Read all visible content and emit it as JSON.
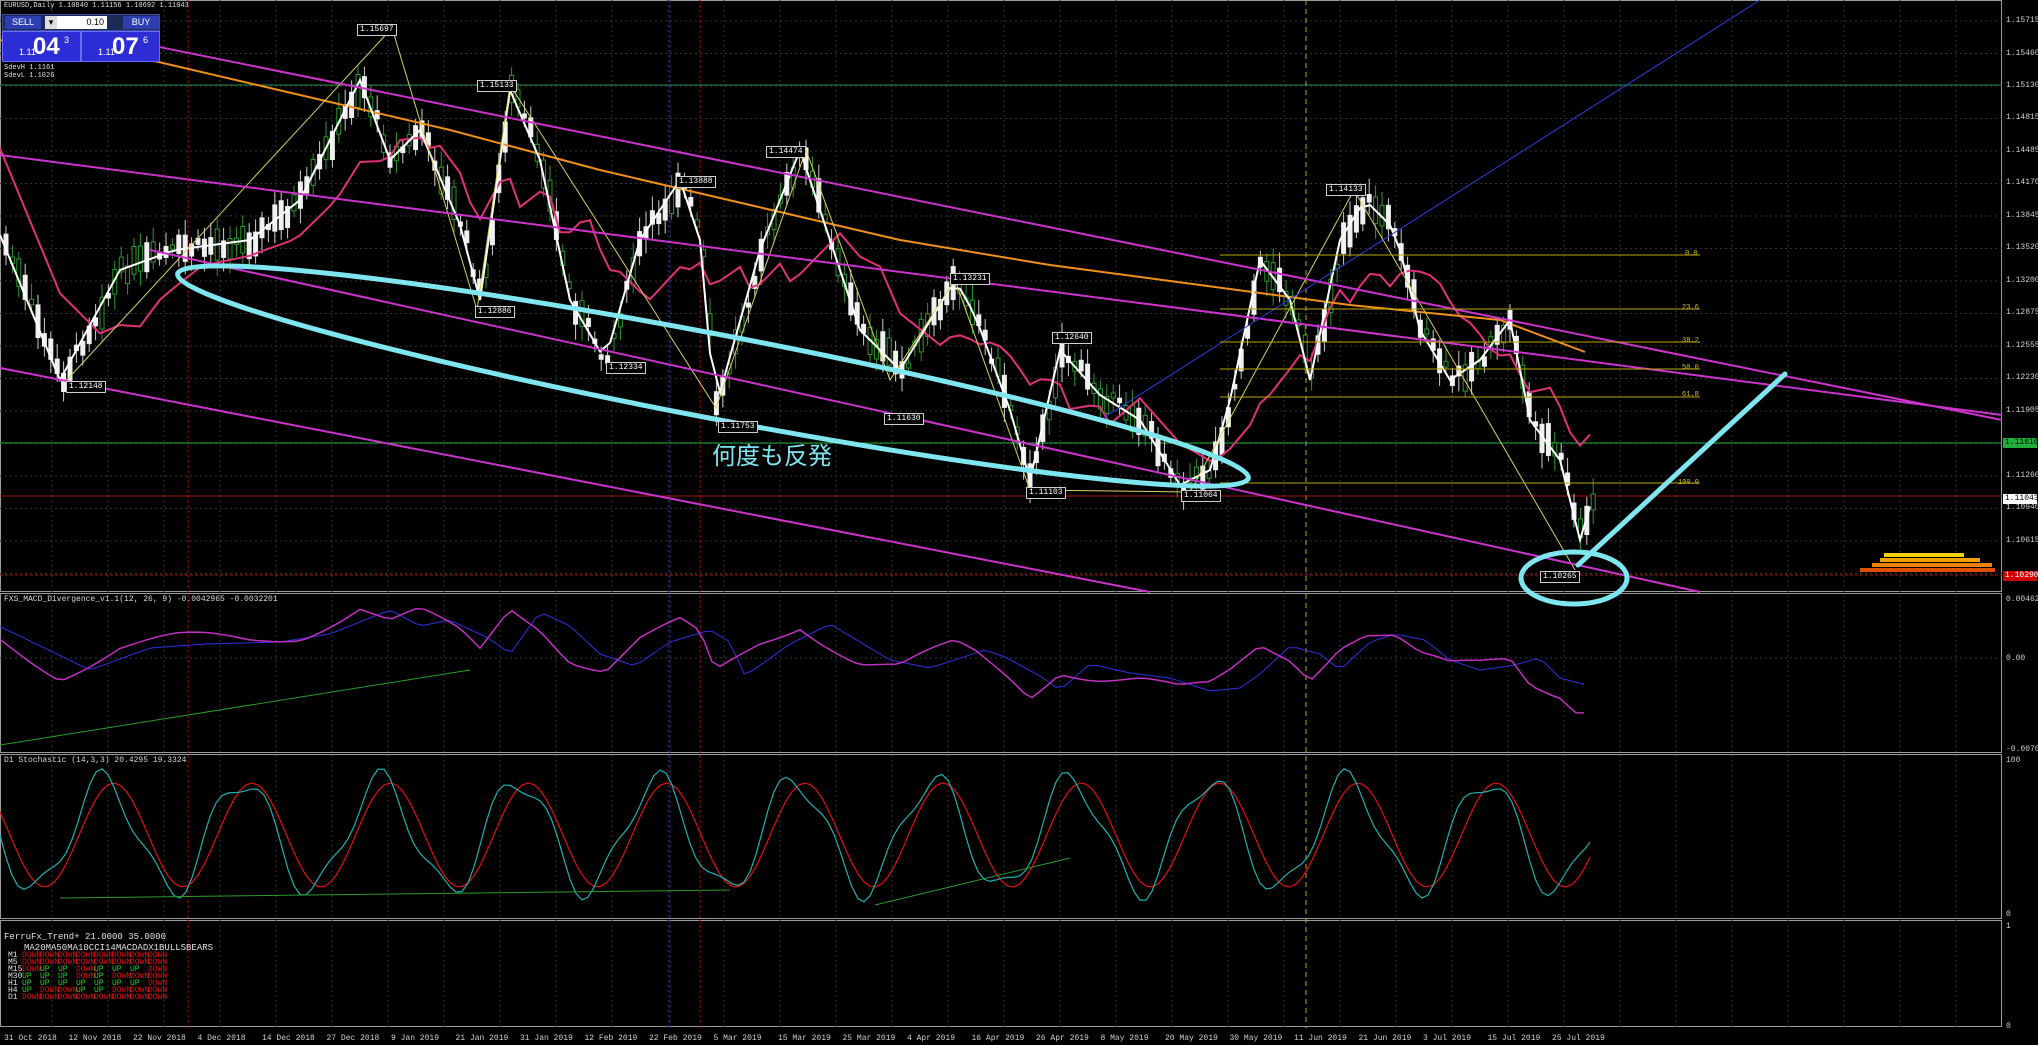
{
  "window": {
    "title": "EURUSD,Daily 1.10840 1.11156 1.10692 1.11043"
  },
  "trade_panel": {
    "sell_label": "SELL",
    "buy_label": "BUY",
    "lot": "0.10",
    "bid_prefix": "1.11",
    "bid_big": "04",
    "bid_sup": "3",
    "ask_prefix": "1.11",
    "ask_big": "07",
    "ask_sup": "6"
  },
  "info_lines": [
    "SdevH 1.1161",
    "SdevL 1.1026"
  ],
  "price_axis": [
    "1.15715",
    "1.15460",
    "1.15130",
    "1.14815",
    "1.14485",
    "1.14170",
    "1.13845",
    "1.13520",
    "1.13200",
    "1.12875",
    "1.12555",
    "1.12230",
    "1.11905",
    "1.11580",
    "1.11260",
    "1.10940",
    "1.10615",
    "1.10290"
  ],
  "price_tags": {
    "green": "1.11610",
    "current": "1.11043",
    "red": "1.10290"
  },
  "zigzag_labels": [
    "1.15697",
    "1.15133",
    "1.14474",
    "1.13888",
    "1.14133",
    "1.13231",
    "1.12640",
    "1.12886",
    "1.12334",
    "1.11753",
    "1.11630",
    "1.11103",
    "1.11064",
    "1.12148",
    "1.10265"
  ],
  "fib_levels": [
    "0.0",
    "23.6",
    "38.2",
    "50.0",
    "61.8",
    "100.0"
  ],
  "annotation": "何度も反発",
  "macd": {
    "label": "FXS_MACD_Divergence_v1.1(12, 26, 9) -0.0042965 -0.0032201",
    "axis": [
      "0.0046224",
      "0.00",
      "-0.007029"
    ]
  },
  "stoch": {
    "label": "D1 Stochastic (14,3,3) 20.4295 19.3324",
    "axis": [
      "100",
      "0"
    ]
  },
  "trend": {
    "label": "FerruFx_Trend+ 21.0000 35.0000",
    "columns": "MA20MA50MA10CCI14MACDADX1BULLSBEARS",
    "rows": [
      {
        "tf": "M1",
        "v": [
          "DOWN",
          "DOWN",
          "DOWN",
          "DOWN",
          "DOWN",
          "DOWN",
          "DOWN",
          "DOWN"
        ]
      },
      {
        "tf": "M5",
        "v": [
          "DOWN",
          "DOWN",
          "DOWN",
          "DOWN",
          "DOWN",
          "DOWN",
          "DOWN",
          "DOWN"
        ]
      },
      {
        "tf": "M15",
        "v": [
          "DOWN",
          "UP",
          "UP",
          "DOWN",
          "UP",
          "UP",
          "UP",
          "DOWN"
        ]
      },
      {
        "tf": "M30",
        "v": [
          "UP",
          "UP",
          "UP",
          "DOWN",
          "UP",
          "DOWN",
          "DOWN",
          "DOWN"
        ]
      },
      {
        "tf": "H1",
        "v": [
          "UP",
          "UP",
          "UP",
          "UP",
          "UP",
          "UP",
          "UP",
          "DOWN"
        ]
      },
      {
        "tf": "H4",
        "v": [
          "UP",
          "DOWN",
          "DOWN",
          "UP",
          "UP",
          "DOWN",
          "DOWN",
          "DOWN"
        ]
      },
      {
        "tf": "D1",
        "v": [
          "DOWN",
          "DOWN",
          "DOWN",
          "DOWN",
          "DOWN",
          "DOWN",
          "DOWN",
          "DOWN"
        ]
      }
    ],
    "axis": [
      "1",
      "0"
    ]
  },
  "date_axis": [
    "31 Oct 2018",
    "12 Nov 2018",
    "22 Nov 2018",
    "4 Dec 2018",
    "14 Dec 2018",
    "27 Dec 2018",
    "9 Jan 2019",
    "21 Jan 2019",
    "31 Jan 2019",
    "12 Feb 2019",
    "22 Feb 2019",
    "5 Mar 2019",
    "15 Mar 2019",
    "25 Mar 2019",
    "4 Apr 2019",
    "16 Apr 2019",
    "26 Apr 2019",
    "8 May 2019",
    "20 May 2019",
    "30 May 2019",
    "11 Jun 2019",
    "21 Jun 2019",
    "3 Jul 2019",
    "15 Jul 2019",
    "25 Jul 2019"
  ],
  "colors": {
    "background": "#000000",
    "annotation": "#7fe6f0",
    "channel": "#cc33cc",
    "fib": "#d4c400"
  }
}
